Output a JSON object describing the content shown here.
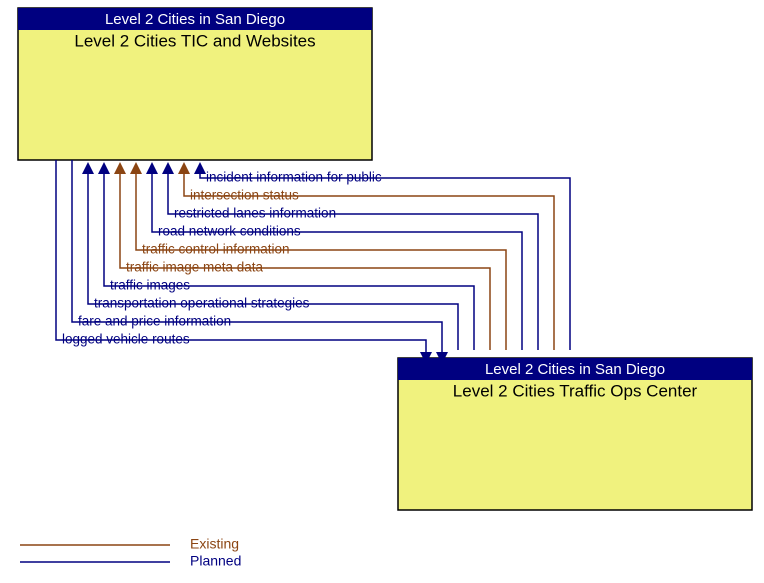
{
  "colors": {
    "planned": "#000080",
    "existing": "#8b4513",
    "box_fill": "#f0f27e",
    "header_fill": "#000080"
  },
  "boxes": {
    "top": {
      "header": "Level 2 Cities in San Diego",
      "title": "Level 2 Cities TIC and Websites"
    },
    "bottom": {
      "header": "Level 2 Cities in San Diego",
      "title": "Level 2 Cities Traffic Ops Center"
    }
  },
  "flows": [
    {
      "label": "incident information for public",
      "status": "planned",
      "direction": "to_top"
    },
    {
      "label": "intersection status",
      "status": "existing",
      "direction": "to_top"
    },
    {
      "label": "restricted lanes information",
      "status": "planned",
      "direction": "to_top"
    },
    {
      "label": "road network conditions",
      "status": "planned",
      "direction": "to_top"
    },
    {
      "label": "traffic control information",
      "status": "existing",
      "direction": "to_top"
    },
    {
      "label": "traffic image meta data",
      "status": "existing",
      "direction": "to_top"
    },
    {
      "label": "traffic images",
      "status": "planned",
      "direction": "to_top"
    },
    {
      "label": "transportation operational strategies",
      "status": "planned",
      "direction": "to_top"
    },
    {
      "label": "fare and price information",
      "status": "planned",
      "direction": "to_bottom"
    },
    {
      "label": "logged vehicle routes",
      "status": "planned",
      "direction": "to_bottom"
    }
  ],
  "legend": {
    "existing": "Existing",
    "planned": "Planned"
  }
}
